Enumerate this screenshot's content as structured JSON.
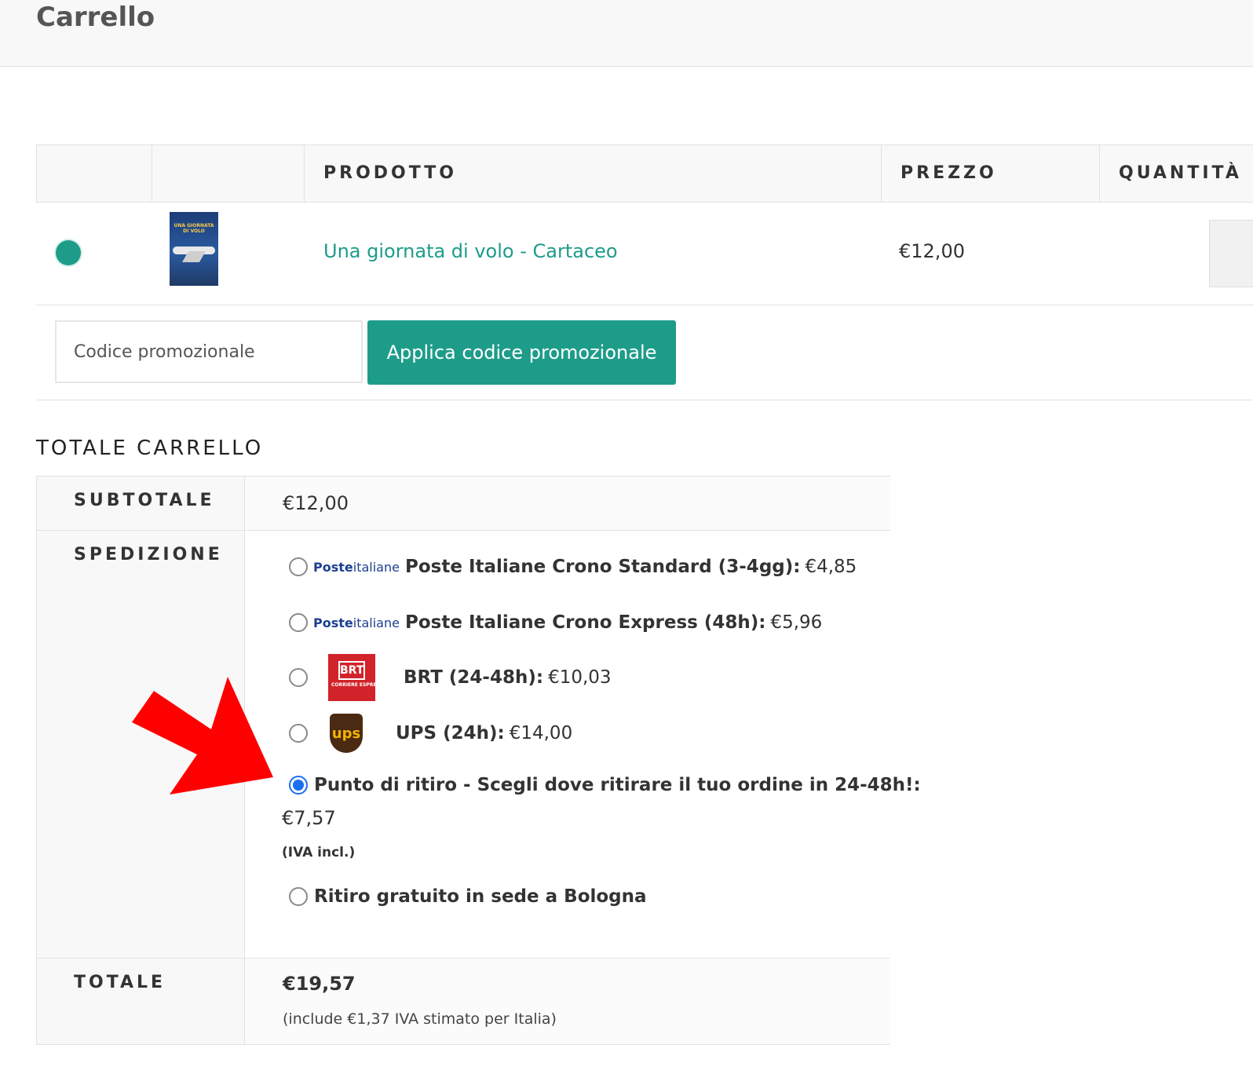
{
  "page": {
    "title": "Carrello"
  },
  "cart": {
    "columns": [
      "",
      "",
      "PRODOTTO",
      "PREZZO",
      "QUANTITÀ"
    ],
    "items": [
      {
        "name": "Una giornata di volo - Cartaceo",
        "price": "€12,00",
        "thumb_text": "UNA GIORNATA DI VOLO"
      }
    ],
    "coupon": {
      "placeholder": "Codice promozionale",
      "button_label": "Applica codice promozionale"
    }
  },
  "totals": {
    "heading": "TOTALE CARRELLO",
    "subtotal_label": "SUBTOTALE",
    "subtotal_value": "€12,00",
    "shipping_label": "SPEDIZIONE",
    "shipping_options": [
      {
        "logo": "Posteitaliane",
        "name": "Poste Italiane Crono Standard (3-4gg):",
        "price": "€4,85",
        "selected": false
      },
      {
        "logo": "Posteitaliane",
        "name": "Poste Italiane Crono Express (48h):",
        "price": "€5,96",
        "selected": false
      },
      {
        "logo": "BRT",
        "logo_sub": "CORRIERE ESPRESSO",
        "name": "BRT (24-48h):",
        "price": "€10,03",
        "selected": false
      },
      {
        "logo": "ups",
        "name": "UPS (24h):",
        "price": "€14,00",
        "selected": false
      },
      {
        "name": "Punto di ritiro - Scegli dove ritirare il tuo ordine in 24-48h!:",
        "price": "€7,57",
        "note": "(IVA incl.)",
        "selected": true
      },
      {
        "name": "Ritiro gratuito in sede a Bologna",
        "selected": false
      }
    ],
    "total_label": "TOTALE",
    "total_value": "€19,57",
    "total_note": "(include €1,37 IVA stimato per Italia)"
  },
  "colors": {
    "accent": "#1e9c8a",
    "radio_selected": "#1a6ef0",
    "annotation_arrow": "#ff0000"
  },
  "icons": [
    "remove-dot-icon",
    "poste-italiane-logo",
    "brt-logo",
    "ups-logo",
    "red-arrow-annotation"
  ]
}
